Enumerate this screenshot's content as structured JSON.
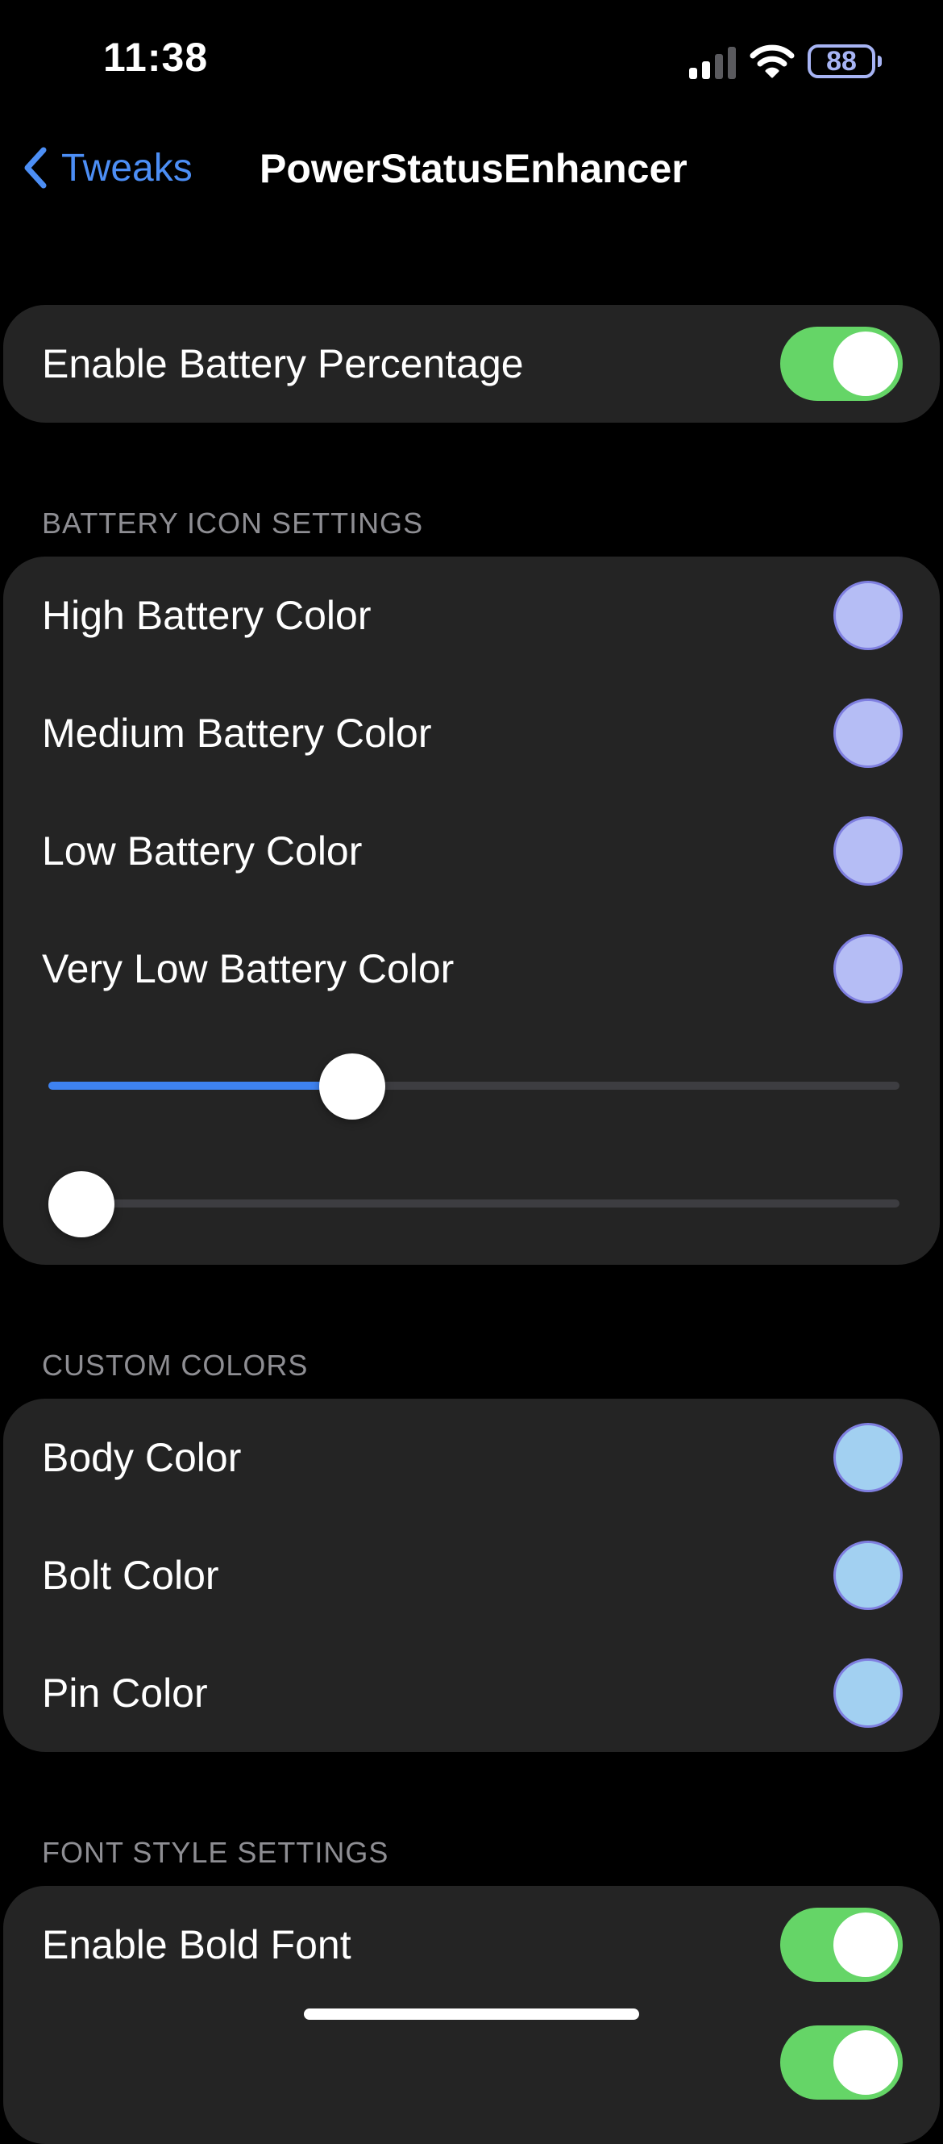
{
  "status_bar": {
    "time": "11:38",
    "battery_level": "88",
    "battery_color": "#a7b4f4",
    "signal_icon": "cellular-signal-icon",
    "wifi_icon": "wifi-icon",
    "battery_icon": "battery-icon"
  },
  "nav": {
    "back_label": "Tweaks",
    "back_icon": "chevron-left-icon",
    "title": "PowerStatusEnhancer",
    "accent_color": "#4c8ef5"
  },
  "main_toggle": {
    "label": "Enable Battery Percentage",
    "on": true
  },
  "battery_icon_settings": {
    "header": "BATTERY ICON SETTINGS",
    "colors": [
      {
        "label": "High Battery Color",
        "swatch": "#b5bdf5"
      },
      {
        "label": "Medium Battery Color",
        "swatch": "#b5bdf5"
      },
      {
        "label": "Low Battery Color",
        "swatch": "#b5bdf5"
      },
      {
        "label": "Very Low Battery Color",
        "swatch": "#b5bdf5"
      }
    ],
    "sliders": [
      {
        "value": 0.345,
        "fill_color": "#3e82f0"
      },
      {
        "value": 0.0
      }
    ]
  },
  "custom_colors": {
    "header": "CUSTOM COLORS",
    "colors": [
      {
        "label": "Body Color",
        "swatch": "#a2d0f1"
      },
      {
        "label": "Bolt Color",
        "swatch": "#a2d0f1"
      },
      {
        "label": "Pin Color",
        "swatch": "#a2d0f1"
      }
    ]
  },
  "font_style_settings": {
    "header": "FONT STYLE SETTINGS",
    "toggles": [
      {
        "label": "Enable Bold Font",
        "on": true
      },
      {
        "label": "",
        "on": true
      }
    ]
  },
  "toggle_on_color": "#65d567"
}
